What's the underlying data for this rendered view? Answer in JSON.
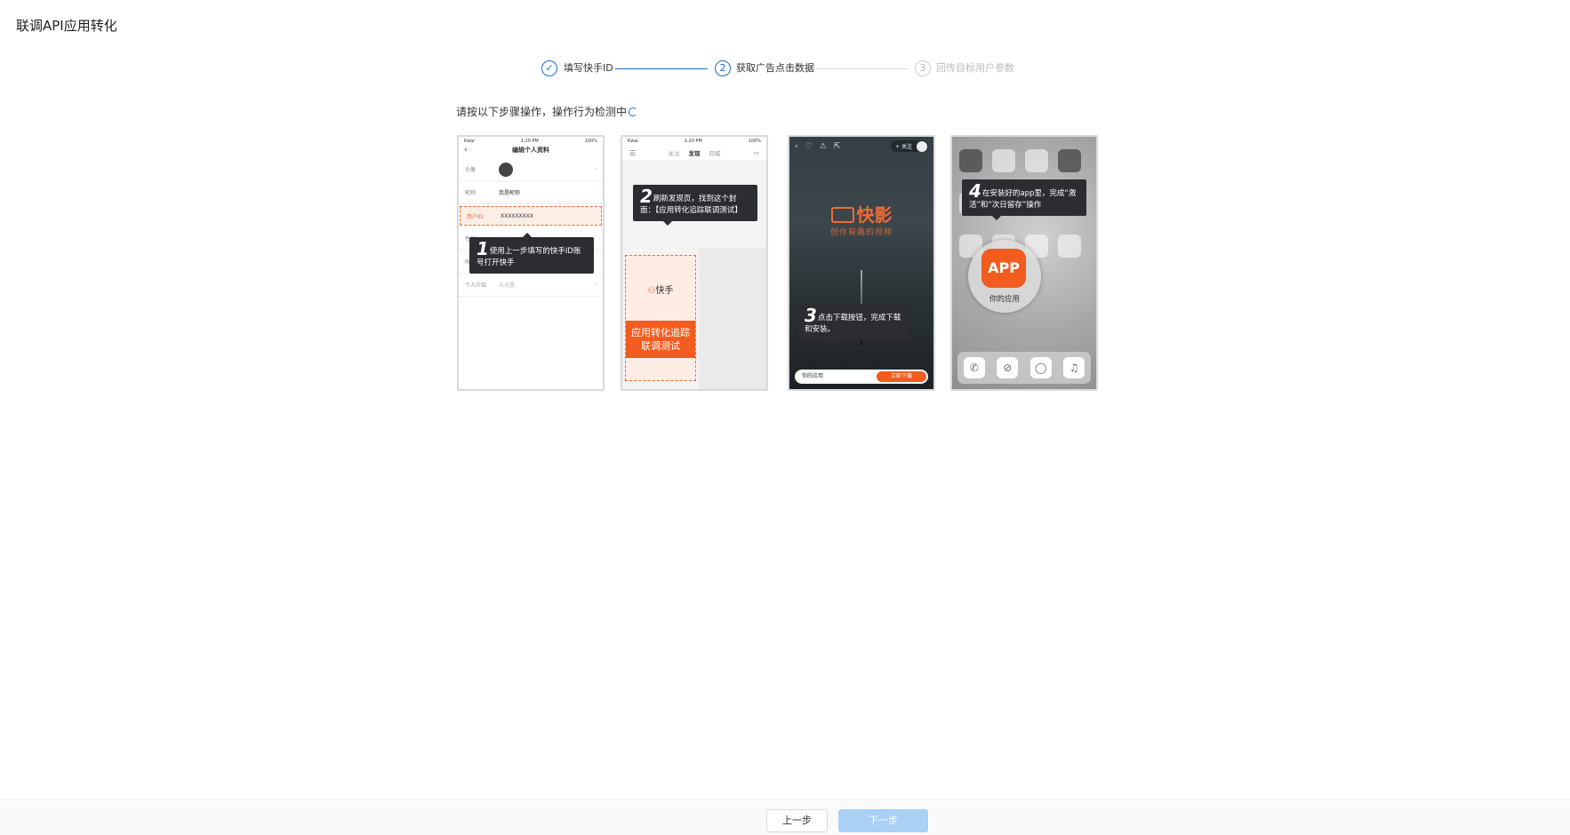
{
  "page": {
    "title": "联调API应用转化"
  },
  "steps": [
    {
      "label": "填写快手ID",
      "status": "done",
      "number": "1"
    },
    {
      "label": "获取广告点击数据",
      "status": "active",
      "number": "2"
    },
    {
      "label": "回传目标用户参数",
      "status": "pending",
      "number": "3"
    }
  ],
  "instruction": {
    "text": "请按以下步骤操作，操作行为检测中"
  },
  "phone1": {
    "status_left": "Kwai",
    "status_mid": "1:20 PM",
    "status_right": "100%",
    "nav_title": "编辑个人资料",
    "rows": [
      {
        "key": "头像",
        "value": ""
      },
      {
        "key": "昵称",
        "value": "我是昵称"
      },
      {
        "key": "用户ID",
        "value": "XXXXXXXXX"
      },
      {
        "key": "性别",
        "value": ""
      },
      {
        "key": "所在地",
        "value": ""
      },
      {
        "key": "个人介绍",
        "value": "未设置"
      }
    ],
    "tip_num": "1",
    "tip_text": "使用上一步填写的快手ID账号打开快手"
  },
  "phone2": {
    "status_left": "Kwai",
    "status_mid": "1:20 PM",
    "status_right": "100%",
    "tabs": [
      "关注",
      "发现",
      "同城"
    ],
    "tip_num": "2",
    "tip_text": "刷新发现页，找到这个封面：【应用转化追踪联调测试】",
    "logo_text": "快手",
    "banner_line1": "应用转化追踪",
    "banner_line2": "联调测试"
  },
  "phone3": {
    "follow_label": "+ 关注",
    "logo_text": "快影",
    "slogan": "创作有趣的视频",
    "tip_num": "3",
    "tip_text": "点击下载按钮，完成下载和安装。",
    "app_label": "你的应用",
    "download_label": "立即下载"
  },
  "phone4": {
    "tip_num": "4",
    "tip_text": "在安装好的app里，完成“激活”和“次日留存”操作",
    "app_icon_text": "APP",
    "app_name": "你的应用"
  },
  "footer": {
    "prev_label": "上一步",
    "next_label": "下一步"
  },
  "colors": {
    "primary": "#1a6fd8",
    "accent": "#f25c1e",
    "disabled_button": "#a9d0f5"
  }
}
